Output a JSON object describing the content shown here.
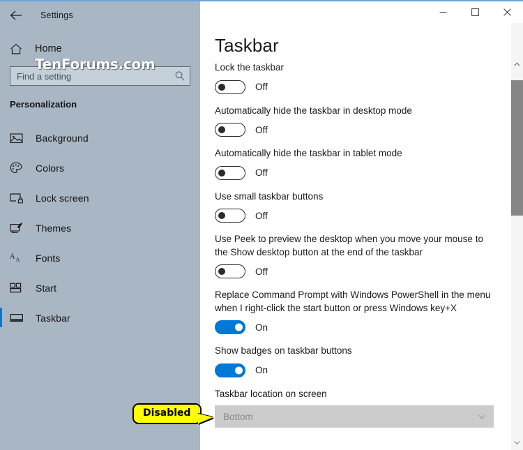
{
  "window": {
    "app_title": "Settings",
    "back_icon": "back-arrow-icon",
    "minimize_label": "Minimize",
    "maximize_label": "Maximize",
    "close_label": "Close",
    "accent_color": "#0078d7",
    "titlebar_border_color": "#6ba5d7"
  },
  "watermark": {
    "text": "TenForums.com"
  },
  "sidebar": {
    "background_color": "#a9b6c4",
    "home": {
      "label": "Home",
      "icon": "home-icon"
    },
    "search": {
      "placeholder": "Find a setting",
      "value": "",
      "icon": "search-icon"
    },
    "section_header": "Personalization",
    "items": [
      {
        "label": "Background",
        "icon": "picture-icon",
        "selected": false
      },
      {
        "label": "Colors",
        "icon": "palette-icon",
        "selected": false
      },
      {
        "label": "Lock screen",
        "icon": "lock-screen-icon",
        "selected": false
      },
      {
        "label": "Themes",
        "icon": "themes-icon",
        "selected": false
      },
      {
        "label": "Fonts",
        "icon": "fonts-icon",
        "selected": false
      },
      {
        "label": "Start",
        "icon": "start-icon",
        "selected": false
      },
      {
        "label": "Taskbar",
        "icon": "taskbar-icon",
        "selected": true
      }
    ]
  },
  "main": {
    "page_title": "Taskbar",
    "settings": [
      {
        "id": "lock-the-taskbar",
        "description": "Lock the taskbar",
        "control": "toggle",
        "state": "Off"
      },
      {
        "id": "auto-hide-desktop-mode",
        "description": "Automatically hide the taskbar in desktop mode",
        "control": "toggle",
        "state": "Off"
      },
      {
        "id": "auto-hide-tablet-mode",
        "description": "Automatically hide the taskbar in tablet mode",
        "control": "toggle",
        "state": "Off"
      },
      {
        "id": "use-small-taskbar-buttons",
        "description": "Use small taskbar buttons",
        "control": "toggle",
        "state": "Off"
      },
      {
        "id": "use-peek-preview-desktop",
        "description": "Use Peek to preview the desktop when you move your mouse to the Show desktop button at the end of the taskbar",
        "control": "toggle",
        "state": "Off"
      },
      {
        "id": "replace-command-prompt-powershell",
        "description": "Replace Command Prompt with Windows PowerShell in the menu when I right-click the start button or press Windows key+X",
        "control": "toggle",
        "state": "On"
      },
      {
        "id": "show-badges-on-taskbar-buttons",
        "description": "Show badges on taskbar buttons",
        "control": "toggle",
        "state": "On"
      },
      {
        "id": "taskbar-location-on-screen",
        "description": "Taskbar location on screen",
        "control": "dropdown",
        "state": "Bottom",
        "disabled": true
      }
    ]
  },
  "callout": {
    "text": "Disabled",
    "fill_color": "#ffff00",
    "border_color": "#000000"
  },
  "scrollbar": {
    "up_arrow": "chevron-up-icon",
    "down_arrow": "chevron-down-icon",
    "thumb_color": "#868686"
  }
}
